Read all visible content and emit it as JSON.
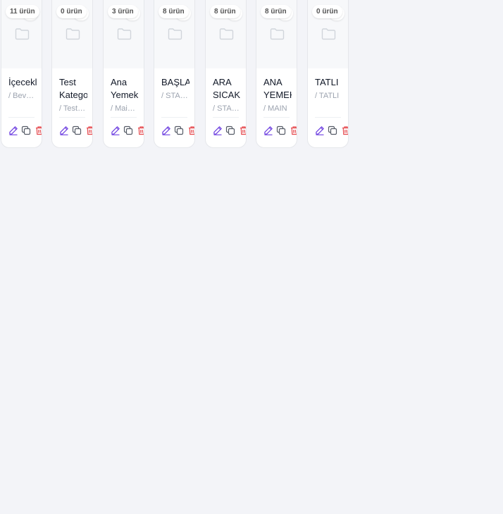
{
  "colors": {
    "edit": "#6d3fe0",
    "copy": "#555b66",
    "delete": "#e5484d",
    "folder": "#d1d5db"
  },
  "icons": {
    "folder": "folder-icon",
    "edit": "pencil-icon",
    "copy": "copy-icon",
    "delete": "trash-icon"
  },
  "categories": [
    {
      "count": "11 ürün",
      "name": "İçecekler",
      "slug": "/ Beverages"
    },
    {
      "count": "0 ürün",
      "name": "Test Kategori",
      "slug": "/ Test Category"
    },
    {
      "count": "3 ürün",
      "name": "Ana Yemek",
      "slug": "/ Main Course"
    },
    {
      "count": "8 ürün",
      "name": "BAŞLANGIÇ",
      "slug": "/ START"
    },
    {
      "count": "8 ürün",
      "name": "ARA SICAK",
      "slug": "/ STARTERS"
    },
    {
      "count": "8 ürün",
      "name": "ANA YEMEK",
      "slug": "/ MAIN"
    },
    {
      "count": "0 ürün",
      "name": "TATLI",
      "slug": "/ TATLI"
    }
  ]
}
